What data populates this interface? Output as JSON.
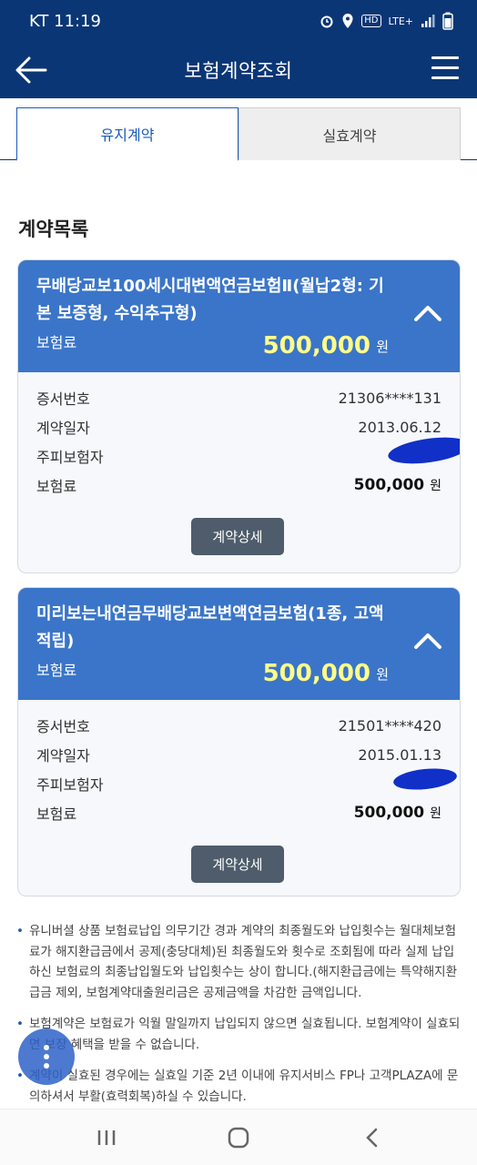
{
  "status": {
    "time": "KT 11:19",
    "hd": "HD",
    "lte": "LTE+"
  },
  "header": {
    "title": "보험계약조회"
  },
  "tabs": [
    {
      "label": "유지계약",
      "active": true
    },
    {
      "label": "실효계약",
      "active": false
    }
  ],
  "section_title": "계약목록",
  "contracts": [
    {
      "name": "무배당교보100세시대변액연금보험Ⅱ(월납2형: 기본 보증형, 수익추구형)",
      "premium_label": "보험료",
      "premium_value": "500,000",
      "premium_unit": "원",
      "rows": [
        {
          "label": "증서번호",
          "value": "21306****131"
        },
        {
          "label": "계약일자",
          "value": "2013.06.12"
        },
        {
          "label": "주피보험자",
          "value": ""
        },
        {
          "label": "보험료",
          "value": "500,000",
          "unit": "원"
        }
      ],
      "detail_button": "계약상세"
    },
    {
      "name": "미리보는내연금무배당교보변액연금보험(1종, 고액적립)",
      "premium_label": "보험료",
      "premium_value": "500,000",
      "premium_unit": "원",
      "rows": [
        {
          "label": "증서번호",
          "value": "21501****420"
        },
        {
          "label": "계약일자",
          "value": "2015.01.13"
        },
        {
          "label": "주피보험자",
          "value": ""
        },
        {
          "label": "보험료",
          "value": "500,000",
          "unit": "원"
        }
      ],
      "detail_button": "계약상세"
    }
  ],
  "notes": [
    "유니버셜 상품 보험료납입 의무기간 경과 계약의 최종월도와 납입횟수는 월대체보험료가 해지환급금에서 공제(충당대체)된 최종월도와 횟수로 조회됨에 따라 실제 납입하신 보험료의 최종납입월도와 납입횟수는 상이 합니다.(해지환급금에는 특약해지환급금 제외, 보험계약대출원리금은 공제금액을 차감한 금액입니다.",
    "보험계약은 보험료가 익월 말일까지 납입되지 않으면 실효됩니다. 보험계약이 실효되면 보장 혜택을 받을 수 없습니다.",
    "계약이 실효된 경우에는 실효일 기준 2년 이내에 유지서비스 FP나 고객PLAZA에 문의하셔서 부활(효력회복)하실 수 있습니다."
  ],
  "colors": {
    "header": "#0b3675",
    "card_head": "#3a75c9",
    "premium_highlight": "#fffc8a",
    "button": "#4e5c6b"
  }
}
